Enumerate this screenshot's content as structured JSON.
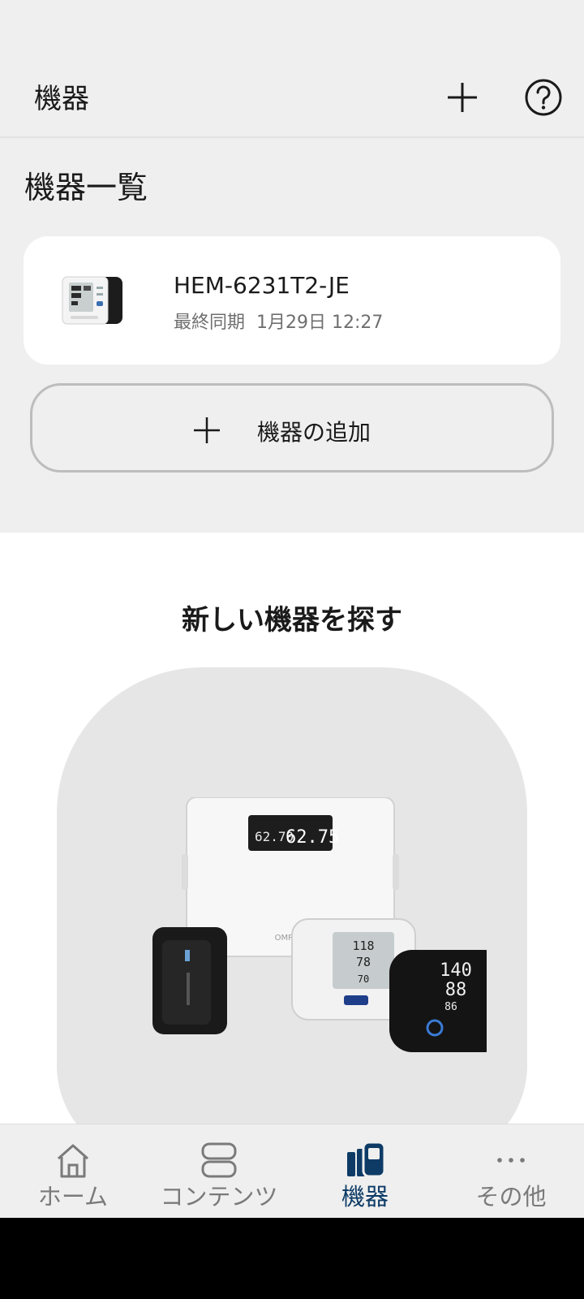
{
  "appbar": {
    "title": "機器",
    "add_icon": "plus-icon",
    "help_icon": "help-circle-icon"
  },
  "section": {
    "title": "機器一覧"
  },
  "device": {
    "name": "HEM-6231T2-JE",
    "sync_label": "最終同期",
    "sync_time": "1月29日 12:27",
    "image": "wrist-blood-pressure-monitor"
  },
  "add_device": {
    "label": "機器の追加",
    "icon": "plus-icon"
  },
  "discover": {
    "title": "新しい機器を探す",
    "image": "omron-devices-collage",
    "scale_readout": [
      "62.70",
      "62.75"
    ],
    "monitor_readout": [
      "118",
      "78",
      "70"
    ],
    "monitor_black_readout": [
      "140",
      "88",
      "86"
    ],
    "brand": "OMRON"
  },
  "bottom_nav": {
    "items": [
      {
        "label": "ホーム",
        "icon": "home-icon",
        "active": false
      },
      {
        "label": "コンテンツ",
        "icon": "contents-icon",
        "active": false
      },
      {
        "label": "機器",
        "icon": "devices-icon",
        "active": true
      },
      {
        "label": "その他",
        "icon": "more-icon",
        "active": false
      }
    ]
  },
  "colors": {
    "background": "#efefef",
    "card": "#ffffff",
    "active_nav": "#0d3b66",
    "inactive_nav": "#7a7a7a"
  }
}
